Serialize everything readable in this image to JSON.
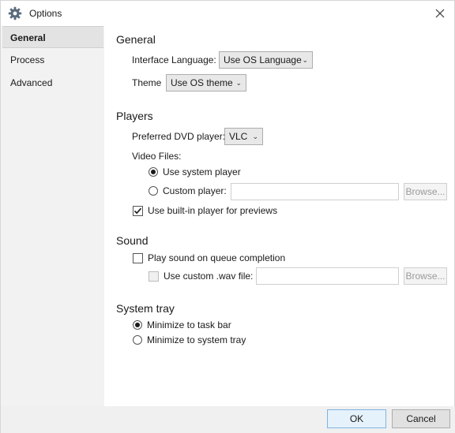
{
  "window": {
    "title": "Options",
    "icon": "gear-icon",
    "close_icon": "close-icon"
  },
  "sidebar": {
    "items": [
      {
        "label": "General",
        "active": true
      },
      {
        "label": "Process",
        "active": false
      },
      {
        "label": "Advanced",
        "active": false
      }
    ]
  },
  "general": {
    "section_title": "General",
    "interface_language_label": "Interface Language:",
    "interface_language_value": "Use OS Language",
    "theme_label": "Theme",
    "theme_value": "Use OS theme"
  },
  "players": {
    "section_title": "Players",
    "preferred_dvd_label": "Preferred DVD player:",
    "preferred_dvd_value": "VLC",
    "video_files_label": "Video Files:",
    "use_system_player_label": "Use system player",
    "use_system_player_selected": true,
    "custom_player_label": "Custom player:",
    "custom_player_selected": false,
    "custom_player_value": "",
    "browse_label": "Browse...",
    "builtin_previews_label": "Use built-in player for previews",
    "builtin_previews_checked": true
  },
  "sound": {
    "section_title": "Sound",
    "play_sound_label": "Play sound on queue completion",
    "play_sound_checked": false,
    "custom_wav_label": "Use custom .wav file:",
    "custom_wav_checked": false,
    "custom_wav_value": "",
    "browse_label": "Browse..."
  },
  "system_tray": {
    "section_title": "System tray",
    "minimize_taskbar_label": "Minimize to task bar",
    "minimize_taskbar_selected": true,
    "minimize_tray_label": "Minimize to system tray",
    "minimize_tray_selected": false
  },
  "footer": {
    "ok_label": "OK",
    "cancel_label": "Cancel"
  }
}
